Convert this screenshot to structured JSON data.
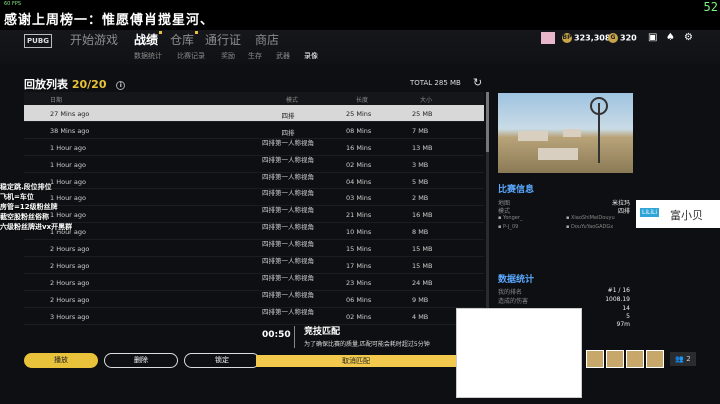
{
  "stream": {
    "banner": "感谢上周榜一：惟愿傅肖搅星河、",
    "fps_label": "60 FPS",
    "fps_value": "52",
    "side_note": "稳定跳.段位排位\n飞机=车位\n房管=12级粉丝牌\n截空股粉丝俗称\n六级粉丝牌进vx开黑群",
    "viewer_tag": "LiLiLi",
    "viewer_text": "富小贝"
  },
  "nav": {
    "logo": "PUBG",
    "items": [
      "开始游戏",
      "战绩",
      "仓库",
      "通行证",
      "商店"
    ],
    "sub_items": [
      "数据统计",
      "比赛记录",
      "奖励",
      "生存",
      "武器",
      "录像"
    ],
    "bp": "323,308",
    "g_coin": "320"
  },
  "replays": {
    "title": "回放列表",
    "count": "20/20",
    "total": "TOTAL 285 MB",
    "headers": [
      "日期",
      "模式",
      "长度",
      "大小"
    ],
    "rows": [
      {
        "date": "27 Mins ago",
        "mode": "四排",
        "length": "25 Mins",
        "size": "25 MB"
      },
      {
        "date": "38 Mins ago",
        "mode": "四排",
        "length": "08 Mins",
        "size": "7 MB"
      },
      {
        "date": "1 Hour ago",
        "mode": "四排第一人称视角",
        "length": "16 Mins",
        "size": "13 MB"
      },
      {
        "date": "1 Hour ago",
        "mode": "四排第一人称视角",
        "length": "02 Mins",
        "size": "3 MB"
      },
      {
        "date": "1 Hour ago",
        "mode": "四排第一人称视角",
        "length": "04 Mins",
        "size": "5 MB"
      },
      {
        "date": "1 Hour ago",
        "mode": "四排第一人称视角",
        "length": "03 Mins",
        "size": "2 MB"
      },
      {
        "date": "1 Hour ago",
        "mode": "四排第一人称视角",
        "length": "21 Mins",
        "size": "16 MB"
      },
      {
        "date": "1 Hour ago",
        "mode": "四排第一人称视角",
        "length": "10 Mins",
        "size": "8 MB"
      },
      {
        "date": "2 Hours ago",
        "mode": "四排第一人称视角",
        "length": "15 Mins",
        "size": "15 MB"
      },
      {
        "date": "2 Hours ago",
        "mode": "四排第一人称视角",
        "length": "17 Mins",
        "size": "15 MB"
      },
      {
        "date": "2 Hours ago",
        "mode": "四排第一人称视角",
        "length": "23 Mins",
        "size": "24 MB"
      },
      {
        "date": "2 Hours ago",
        "mode": "四排第一人称视角",
        "length": "06 Mins",
        "size": "9 MB"
      },
      {
        "date": "3 Hours ago",
        "mode": "四排第一人称视角",
        "length": "02 Mins",
        "size": "4 MB"
      }
    ]
  },
  "match_info": {
    "title": "比赛信息",
    "map_label": "地图",
    "map_value": "米拉玛",
    "mode_label": "模式",
    "mode_value": "四排",
    "players": [
      "Yonger_",
      "XiaoShiMeiDouyu",
      "P-J_09",
      "DouYuYaoGADGx"
    ]
  },
  "stats": {
    "title": "数据统计",
    "rank_label": "我的排名",
    "rank_value": "#1 / 16",
    "damage_label": "造成的伤害",
    "damage_value": "1008.19",
    "kills_value": "14",
    "assists_value": "5",
    "distance_value": "97m"
  },
  "buttons": {
    "play": "播放",
    "delete": "删除",
    "lock": "锁定",
    "cancel_match": "取消匹配"
  },
  "matchmaking": {
    "timer": "00:50",
    "title": "竞技匹配",
    "desc": "为了确保比赛的质量,匹配可能会耗时超过5分钟"
  },
  "party": {
    "count": "2"
  }
}
